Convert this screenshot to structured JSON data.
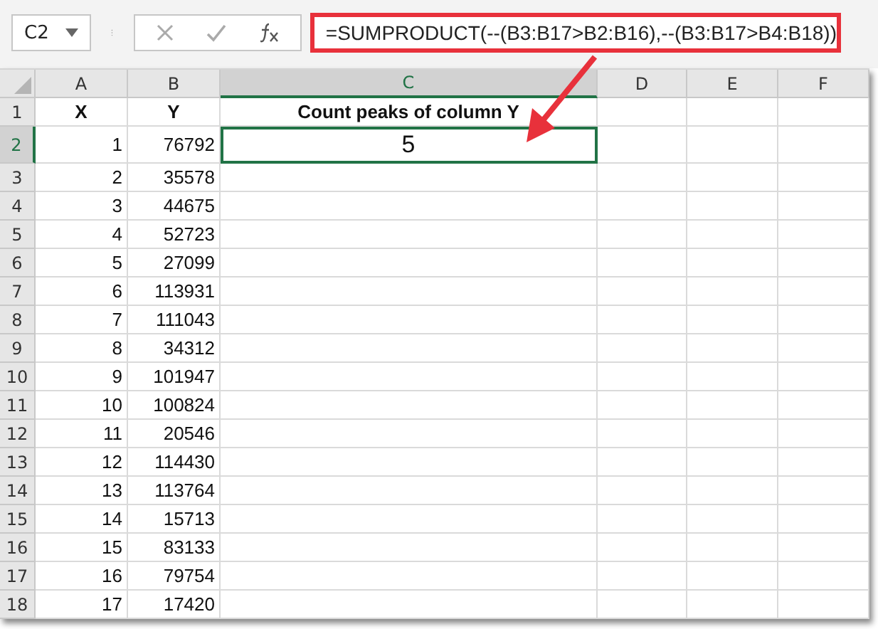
{
  "formula_bar": {
    "name_box": "C2",
    "formula": "=SUMPRODUCT(--(B3:B17>B2:B16),--(B3:B17>B4:B18))",
    "highlighted": true
  },
  "columns": [
    {
      "label": "A",
      "selected": false
    },
    {
      "label": "B",
      "selected": false
    },
    {
      "label": "C",
      "selected": true
    },
    {
      "label": "D",
      "selected": false
    },
    {
      "label": "E",
      "selected": false
    },
    {
      "label": "F",
      "selected": false
    }
  ],
  "rows": [
    {
      "number": "1",
      "selected": false,
      "cells": [
        {
          "text": "X",
          "kind": "header"
        },
        {
          "text": "Y",
          "kind": "header"
        },
        {
          "text": "Count peaks of column Y",
          "kind": "header"
        }
      ]
    },
    {
      "number": "2",
      "selected": true,
      "cells": [
        {
          "text": "1",
          "kind": "number"
        },
        {
          "text": "76792",
          "kind": "number"
        },
        {
          "text": "5",
          "kind": "result"
        }
      ]
    },
    {
      "number": "3",
      "selected": false,
      "cells": [
        {
          "text": "2",
          "kind": "number"
        },
        {
          "text": "35578",
          "kind": "number"
        }
      ]
    },
    {
      "number": "4",
      "selected": false,
      "cells": [
        {
          "text": "3",
          "kind": "number"
        },
        {
          "text": "44675",
          "kind": "number"
        }
      ]
    },
    {
      "number": "5",
      "selected": false,
      "cells": [
        {
          "text": "4",
          "kind": "number"
        },
        {
          "text": "52723",
          "kind": "number"
        }
      ]
    },
    {
      "number": "6",
      "selected": false,
      "cells": [
        {
          "text": "5",
          "kind": "number"
        },
        {
          "text": "27099",
          "kind": "number"
        }
      ]
    },
    {
      "number": "7",
      "selected": false,
      "cells": [
        {
          "text": "6",
          "kind": "number"
        },
        {
          "text": "113931",
          "kind": "number"
        }
      ]
    },
    {
      "number": "8",
      "selected": false,
      "cells": [
        {
          "text": "7",
          "kind": "number"
        },
        {
          "text": "111043",
          "kind": "number"
        }
      ]
    },
    {
      "number": "9",
      "selected": false,
      "cells": [
        {
          "text": "8",
          "kind": "number"
        },
        {
          "text": "34312",
          "kind": "number"
        }
      ]
    },
    {
      "number": "10",
      "selected": false,
      "cells": [
        {
          "text": "9",
          "kind": "number"
        },
        {
          "text": "101947",
          "kind": "number"
        }
      ]
    },
    {
      "number": "11",
      "selected": false,
      "cells": [
        {
          "text": "10",
          "kind": "number"
        },
        {
          "text": "100824",
          "kind": "number"
        }
      ]
    },
    {
      "number": "12",
      "selected": false,
      "cells": [
        {
          "text": "11",
          "kind": "number"
        },
        {
          "text": "20546",
          "kind": "number"
        }
      ]
    },
    {
      "number": "13",
      "selected": false,
      "cells": [
        {
          "text": "12",
          "kind": "number"
        },
        {
          "text": "114430",
          "kind": "number"
        }
      ]
    },
    {
      "number": "14",
      "selected": false,
      "cells": [
        {
          "text": "13",
          "kind": "number"
        },
        {
          "text": "113764",
          "kind": "number"
        }
      ]
    },
    {
      "number": "15",
      "selected": false,
      "cells": [
        {
          "text": "14",
          "kind": "number"
        },
        {
          "text": "15713",
          "kind": "number"
        }
      ]
    },
    {
      "number": "16",
      "selected": false,
      "cells": [
        {
          "text": "15",
          "kind": "number"
        },
        {
          "text": "83133",
          "kind": "number"
        }
      ]
    },
    {
      "number": "17",
      "selected": false,
      "cells": [
        {
          "text": "16",
          "kind": "number"
        },
        {
          "text": "79754",
          "kind": "number"
        }
      ]
    },
    {
      "number": "18",
      "selected": false,
      "cells": [
        {
          "text": "17",
          "kind": "number"
        },
        {
          "text": "17420",
          "kind": "number"
        }
      ]
    }
  ]
}
